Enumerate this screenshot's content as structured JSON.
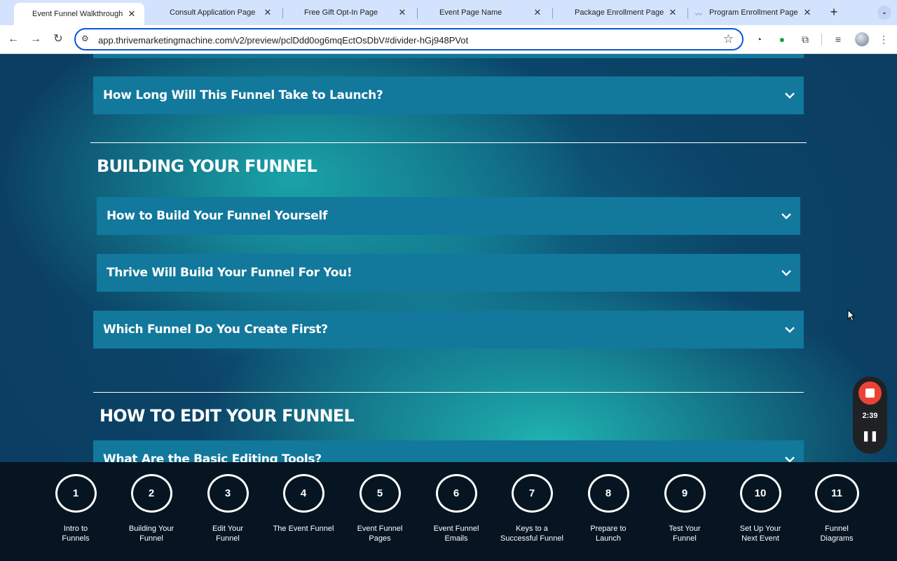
{
  "tabs": [
    {
      "title": "Event Funnel Walkthrough",
      "active": true
    },
    {
      "title": "Consult Application Page",
      "active": false
    },
    {
      "title": "Free Gift Opt-In Page",
      "active": false
    },
    {
      "title": "Event Page Name",
      "active": false
    },
    {
      "title": "Package Enrollment Page",
      "active": false
    },
    {
      "title": "Program Enrollment Page",
      "active": false
    }
  ],
  "address_bar": {
    "url": "app.thrivemarketingmachine.com/v2/preview/pclDdd0og6mqEctOsDbV#divider-hGj948PVot"
  },
  "accordion_top": {
    "label": "How Long Will This Funnel Take to Launch?"
  },
  "section_building": {
    "heading": "BUILDING YOUR FUNNEL",
    "items": [
      {
        "label": "How to Build Your Funnel Yourself"
      },
      {
        "label": "Thrive Will Build Your Funnel For You!"
      },
      {
        "label": "Which Funnel Do You Create First?"
      }
    ]
  },
  "section_edit": {
    "heading": "HOW TO EDIT YOUR FUNNEL",
    "items": [
      {
        "label": "What Are the Basic Editing Tools?"
      }
    ]
  },
  "recorder": {
    "time": "2:39"
  },
  "steps": [
    {
      "number": "1",
      "line1": "Intro to",
      "line2": "Funnels"
    },
    {
      "number": "2",
      "line1": "Building Your",
      "line2": "Funnel"
    },
    {
      "number": "3",
      "line1": "Edit Your",
      "line2": "Funnel"
    },
    {
      "number": "4",
      "line1": "The Event Funnel",
      "line2": ""
    },
    {
      "number": "5",
      "line1": "Event Funnel",
      "line2": "Pages"
    },
    {
      "number": "6",
      "line1": "Event Funnel",
      "line2": "Emails"
    },
    {
      "number": "7",
      "line1": "Keys to a",
      "line2": "Successful Funnel"
    },
    {
      "number": "8",
      "line1": "Prepare to",
      "line2": "Launch"
    },
    {
      "number": "9",
      "line1": "Test Your",
      "line2": "Funnel"
    },
    {
      "number": "10",
      "line1": "Set Up Your",
      "line2": "Next Event"
    },
    {
      "number": "11",
      "line1": "Funnel",
      "line2": "Diagrams"
    }
  ],
  "colors": {
    "accordion_bg": "#12789c",
    "recorder_stop": "#ea4335",
    "address_border": "#0b57d0"
  },
  "icons": [
    "back-icon",
    "forward-icon",
    "reload-icon",
    "site-info-icon",
    "star-icon",
    "extensions-icon",
    "chevron-down-icon",
    "stop-icon",
    "pause-icon"
  ]
}
